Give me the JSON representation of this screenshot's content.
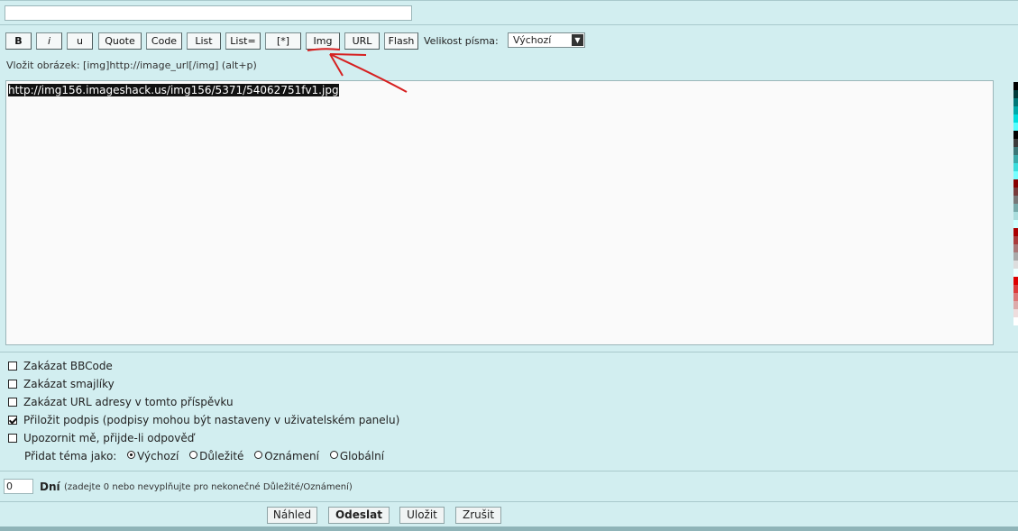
{
  "subject": {
    "value": ""
  },
  "toolbar": {
    "buttons": [
      "B",
      "i",
      "u",
      "Quote",
      "Code",
      "List",
      "List=",
      "[*]",
      "Img",
      "URL",
      "Flash"
    ],
    "font_size_label": "Velikost písma:",
    "font_size_value": "Výchozí"
  },
  "help_text": "Vložit obrázek: [img]http://image_url[/img]  (alt+p)",
  "message": {
    "selected_text": "http://img156.imageshack.us/img156/5371/54062751fv1.jpg"
  },
  "palette_colors": [
    "#000000",
    "#003b3b",
    "#007777",
    "#00aaaa",
    "#00dddd",
    "#55ffff",
    "#000000",
    "#3b3b3b",
    "#3b7777",
    "#3baaaa",
    "#3bdddd",
    "#77ffff",
    "#880000",
    "#773b3b",
    "#777777",
    "#77aaaa",
    "#aadddd",
    "#ccffff",
    "#aa0000",
    "#aa3b3b",
    "#aa7777",
    "#aaaaaa",
    "#dddddd",
    "#eeffff",
    "#dd0000",
    "#dd3b3b",
    "#dd7777",
    "#ddaaaa",
    "#eedddd",
    "#ffffff"
  ],
  "options": [
    {
      "label": "Zakázat BBCode",
      "checked": false
    },
    {
      "label": "Zakázat smajlíky",
      "checked": false
    },
    {
      "label": "Zakázat URL adresy v tomto příspěvku",
      "checked": false
    },
    {
      "label": "Přiložit podpis (podpisy mohou být nastaveny v uživatelském panelu)",
      "checked": true
    },
    {
      "label": "Upozornit mě, přijde-li odpověď",
      "checked": false
    }
  ],
  "topic_type": {
    "label": "Přidat téma jako:",
    "choices": [
      "Výchozí",
      "Důležité",
      "Oznámení",
      "Globální"
    ],
    "selected": "Výchozí"
  },
  "days": {
    "value": "0",
    "label": "Dní",
    "note": "(zadejte 0 nebo nevyplňujte pro nekonečné Důležité/Oznámení)"
  },
  "actions": [
    "Náhled",
    "Odeslat",
    "Uložit",
    "Zrušit"
  ],
  "annotation_color": "#d62020"
}
